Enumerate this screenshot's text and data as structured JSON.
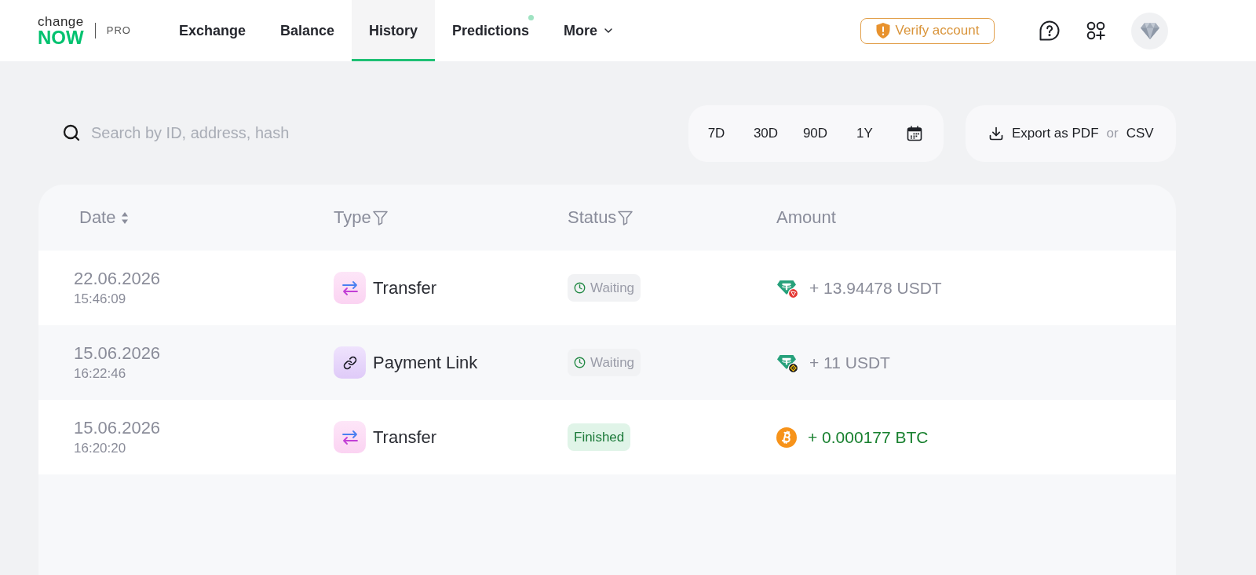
{
  "header": {
    "logo": {
      "top": "change",
      "bottom": "NOW",
      "edition": "PRO"
    },
    "nav": [
      {
        "label": "Exchange",
        "selected": false,
        "dot": false,
        "kind": "link"
      },
      {
        "label": "Balance",
        "selected": false,
        "dot": false,
        "kind": "link"
      },
      {
        "label": "History",
        "selected": true,
        "dot": false,
        "kind": "link"
      },
      {
        "label": "Predictions",
        "selected": false,
        "dot": true,
        "kind": "link"
      },
      {
        "label": "More",
        "selected": false,
        "dot": false,
        "kind": "dropdown"
      }
    ],
    "verify_button": {
      "label": "Verify account"
    }
  },
  "toolbar": {
    "search": {
      "placeholder": "Search by ID, address, hash"
    },
    "periods": [
      {
        "label": "7D",
        "selected": false
      },
      {
        "label": "30D",
        "selected": false
      },
      {
        "label": "90D",
        "selected": false
      },
      {
        "label": "1Y",
        "selected": false
      }
    ],
    "export": {
      "pdf": "Export as PDF",
      "or": "or",
      "csv": "CSV"
    }
  },
  "table": {
    "columns": [
      {
        "label": "Date",
        "kind": "sortable"
      },
      {
        "label": "Type",
        "kind": "filterable"
      },
      {
        "label": "Status",
        "kind": "filterable"
      },
      {
        "label": "Amount",
        "kind": "plain"
      }
    ],
    "rows": [
      {
        "date": "22.06.2026",
        "time": "15:46:09",
        "type": {
          "kind": "transfer",
          "label": "Transfer"
        },
        "status": {
          "kind": "waiting",
          "label": "Waiting"
        },
        "amount": {
          "kind": "usdt_trc20",
          "text": "+ 13.94478 USDT"
        }
      },
      {
        "date": "15.06.2026",
        "time": "16:22:46",
        "type": {
          "kind": "payment_link",
          "label": "Payment Link"
        },
        "status": {
          "kind": "waiting",
          "label": "Waiting"
        },
        "amount": {
          "kind": "usdt_bep20",
          "text": "+ 11 USDT"
        }
      },
      {
        "date": "15.06.2026",
        "time": "16:20:20",
        "type": {
          "kind": "transfer",
          "label": "Transfer"
        },
        "status": {
          "kind": "finished",
          "label": "Finished"
        },
        "amount": {
          "kind": "btc",
          "text": "+ 0.000177 BTC"
        }
      }
    ]
  }
}
